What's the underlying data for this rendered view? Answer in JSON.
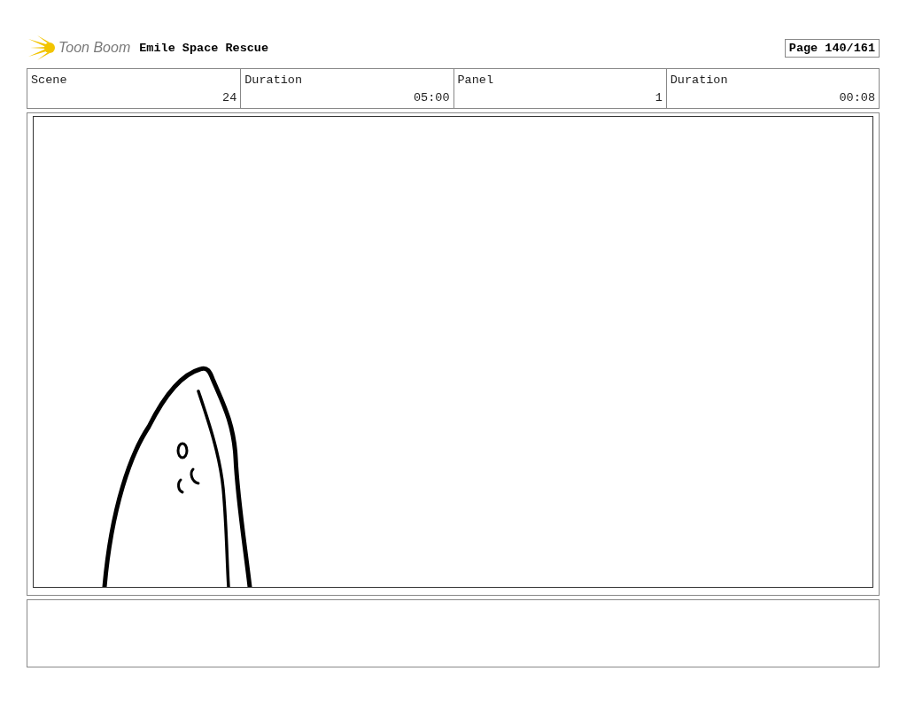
{
  "header": {
    "logo_text": "Toon Boom",
    "title": "Emile Space Rescue",
    "page": "Page 140/161"
  },
  "info_table": {
    "columns": [
      "Scene",
      "Duration",
      "Panel",
      "Duration"
    ],
    "rows": [
      [
        "24",
        "05:00",
        "1",
        "00:08"
      ]
    ]
  }
}
